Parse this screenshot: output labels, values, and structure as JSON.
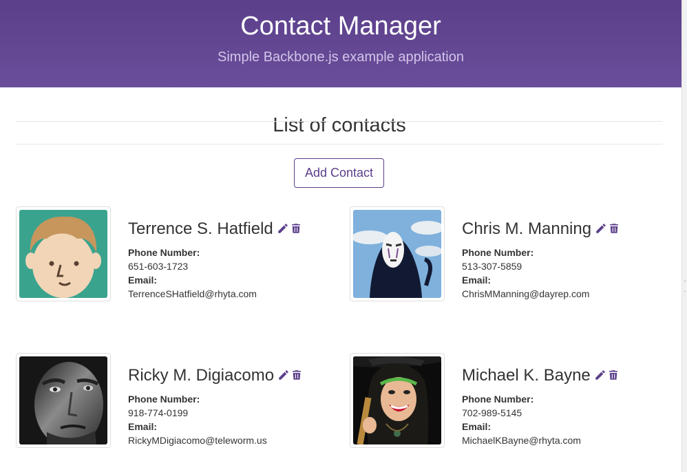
{
  "header": {
    "title": "Contact Manager",
    "subtitle": "Simple Backbone.js example application"
  },
  "main": {
    "section_title": "List of contacts",
    "add_button_label": "Add Contact",
    "phone_label": "Phone Number:",
    "email_label": "Email:"
  },
  "contacts": [
    {
      "name": "Terrence S. Hatfield",
      "phone": "651-603-1723",
      "email": "TerrenceSHatfield@rhyta.com",
      "avatar": "cartoon-face-avatar"
    },
    {
      "name": "Chris M. Manning",
      "phone": "513-307-5859",
      "email": "ChrisMManning@dayrep.com",
      "avatar": "masked-figure-avatar"
    },
    {
      "name": "Ricky M. Digiacomo",
      "phone": "918-774-0199",
      "email": "RickyMDigiacomo@teleworm.us",
      "avatar": "grayscale-face-avatar"
    },
    {
      "name": "Michael K. Bayne",
      "phone": "702-989-5145",
      "email": "MichaelKBayne@rhyta.com",
      "avatar": "witch-hat-avatar"
    }
  ],
  "icons": {
    "edit": "pencil-icon",
    "delete": "trash-icon"
  },
  "colors": {
    "brand": "#5b3f8a",
    "subtitle": "#d3c5e9",
    "text": "#333333"
  }
}
